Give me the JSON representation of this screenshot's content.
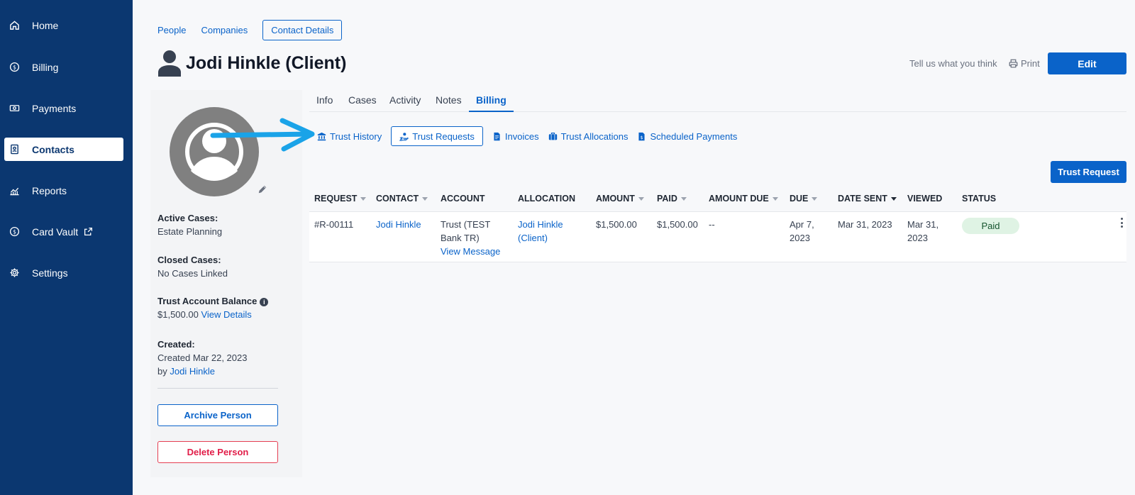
{
  "sidebar": {
    "items": [
      {
        "label": "Home",
        "icon": "home-icon"
      },
      {
        "label": "Billing",
        "icon": "dollar-circle-icon"
      },
      {
        "label": "Payments",
        "icon": "cash-icon"
      },
      {
        "label": "Contacts",
        "icon": "contact-book-icon",
        "active": true
      },
      {
        "label": "Reports",
        "icon": "chart-icon"
      },
      {
        "label": "Card Vault",
        "icon": "dollar-circle-icon",
        "external": true
      },
      {
        "label": "Settings",
        "icon": "gear-icon"
      }
    ]
  },
  "breadcrumb": {
    "people": "People",
    "companies": "Companies",
    "current": "Contact Details"
  },
  "header": {
    "title": "Jodi Hinkle (Client)",
    "feedback": "Tell us what you think",
    "print": "Print",
    "edit": "Edit"
  },
  "profile": {
    "active_cases_label": "Active Cases:",
    "active_cases_value": "Estate Planning",
    "closed_cases_label": "Closed Cases:",
    "closed_cases_value": "No Cases Linked",
    "trust_balance_label": "Trust Account Balance",
    "trust_balance_value": "$1,500.00",
    "view_details": "View Details",
    "created_label": "Created:",
    "created_value": "Created Mar 22, 2023",
    "created_by_prefix": "by",
    "created_by": "Jodi Hinkle",
    "archive": "Archive Person",
    "delete": "Delete Person"
  },
  "tabs": [
    "Info",
    "Cases",
    "Activity",
    "Notes",
    "Billing"
  ],
  "active_tab": "Billing",
  "subnav": {
    "trust_history": "Trust History",
    "trust_requests": "Trust Requests",
    "invoices": "Invoices",
    "trust_allocations": "Trust Allocations",
    "scheduled_payments": "Scheduled Payments"
  },
  "trust_request_button": "Trust Request",
  "table": {
    "headers": {
      "request": "REQUEST",
      "contact": "CONTACT",
      "account": "ACCOUNT",
      "allocation": "ALLOCATION",
      "amount": "AMOUNT",
      "paid": "PAID",
      "amount_due": "AMOUNT DUE",
      "due": "DUE",
      "date_sent": "DATE SENT",
      "viewed": "VIEWED",
      "status": "STATUS"
    },
    "rows": [
      {
        "request": "#R-00111",
        "contact": "Jodi Hinkle",
        "account_line1": "Trust (TEST",
        "account_line2": "Bank TR)",
        "account_link": "View Message",
        "allocation_line1": "Jodi Hinkle",
        "allocation_line2": "(Client)",
        "amount": "$1,500.00",
        "paid": "$1,500.00",
        "amount_due": "--",
        "due_line1": "Apr 7,",
        "due_line2": "2023",
        "date_sent": "Mar 31, 2023",
        "viewed_line1": "Mar 31,",
        "viewed_line2": "2023",
        "status": "Paid"
      }
    ]
  },
  "colors": {
    "sidebar": "#0b3770",
    "accent": "#0a63c9",
    "danger": "#e11d48",
    "paid_badge": "#dff3e4",
    "annotation_arrow": "#1aa3e8"
  }
}
